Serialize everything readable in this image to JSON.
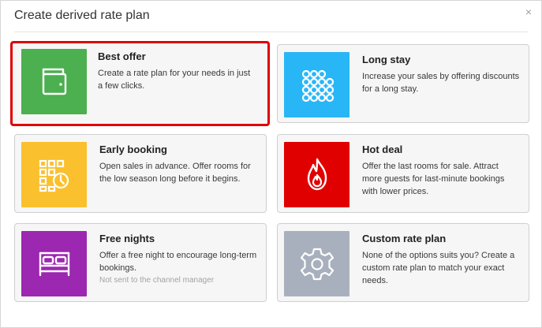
{
  "dialog": {
    "title": "Create derived rate plan",
    "close_glyph": "×"
  },
  "cards": [
    {
      "title": "Best offer",
      "description": "Create a rate plan for your needs in just a few clicks.",
      "icon": "wallet-icon",
      "color": "#4caf50",
      "selected": true
    },
    {
      "title": "Long stay",
      "description": "Increase your sales by offering discounts for a long stay.",
      "icon": "dots-grid-icon",
      "color": "#29b6f6",
      "selected": false
    },
    {
      "title": "Early booking",
      "description": "Open sales in advance. Offer rooms for the low season long before it begins.",
      "icon": "calendar-clock-icon",
      "color": "#fbc02d",
      "selected": false
    },
    {
      "title": "Hot deal",
      "description": "Offer the last rooms for sale. Attract more guests for last-minute bookings with lower prices.",
      "icon": "flame-icon",
      "color": "#e00000",
      "selected": false
    },
    {
      "title": "Free nights",
      "description": "Offer a free night to encourage long-term bookings.",
      "note": "Not sent to the channel manager",
      "icon": "bed-icon",
      "color": "#9c27b0",
      "selected": false
    },
    {
      "title": "Custom rate plan",
      "description": "None of the options suits you? Create a custom rate plan to match your exact needs.",
      "icon": "gear-icon",
      "color": "#a9b0bd",
      "selected": false
    }
  ]
}
